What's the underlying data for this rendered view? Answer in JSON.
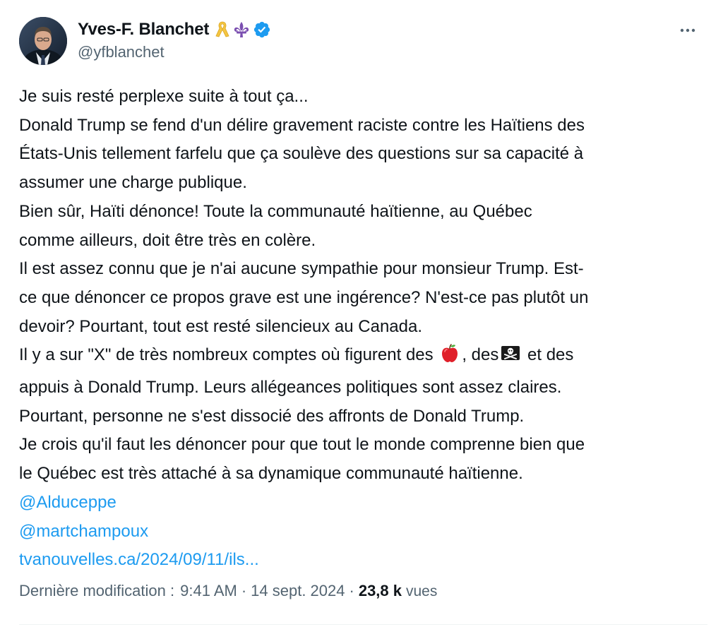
{
  "author": {
    "display_name": "Yves-F. Blanchet",
    "handle": "@yfblanchet",
    "badges": [
      "yellow-ribbon-icon",
      "fleur-de-lis-icon",
      "verified-badge-icon"
    ],
    "verified_color": "#1d9bf0"
  },
  "more_button": {
    "icon": "more-horizontal-icon",
    "label": "···"
  },
  "tweet": {
    "lines": [
      "Je suis resté perplexe suite à tout ça...",
      "Donald Trump se fend d'un délire gravement raciste contre les Haïtiens des",
      "États-Unis tellement farfelu que ça soulève des questions sur sa capacité à",
      "assumer une charge publique.",
      "Bien sûr, Haïti dénonce! Toute la communauté haïtienne, au Québec",
      "comme ailleurs, doit être très en colère.",
      "Il est assez connu que je n'ai aucune sympathie pour monsieur Trump. Est-",
      "ce que dénoncer ce propos grave est une ingérence? N'est-ce pas plutôt un",
      "devoir? Pourtant, tout est resté silencieux au Canada."
    ],
    "emoji_line": {
      "part1": "Il y a sur \"X\" de très nombreux comptes où figurent des ",
      "emoji1": "red-apple-icon",
      "part2": ", des",
      "emoji2": "pirate-flag-icon",
      "part3": " et des"
    },
    "lines_after": [
      "appuis à Donald Trump. Leurs allégeances politiques sont assez claires.",
      "Pourtant, personne ne s'est dissocié des affronts de Donald Trump.",
      "Je crois qu'il faut les dénoncer pour que tout le monde comprenne bien que",
      "le Québec est très attaché à sa dynamique communauté haïtienne."
    ],
    "mentions": [
      "@Alduceppe",
      "@martchampoux"
    ],
    "link": "tvanouvelles.ca/2024/09/11/ils..."
  },
  "meta": {
    "edited_label": "Dernière modification :",
    "time": "9:41 AM",
    "separator": "·",
    "date": "14 sept. 2024",
    "views_count": "23,8 k",
    "views_label": "vues"
  },
  "colors": {
    "text": "#0f1419",
    "secondary": "#536471",
    "link": "#1d9bf0"
  }
}
